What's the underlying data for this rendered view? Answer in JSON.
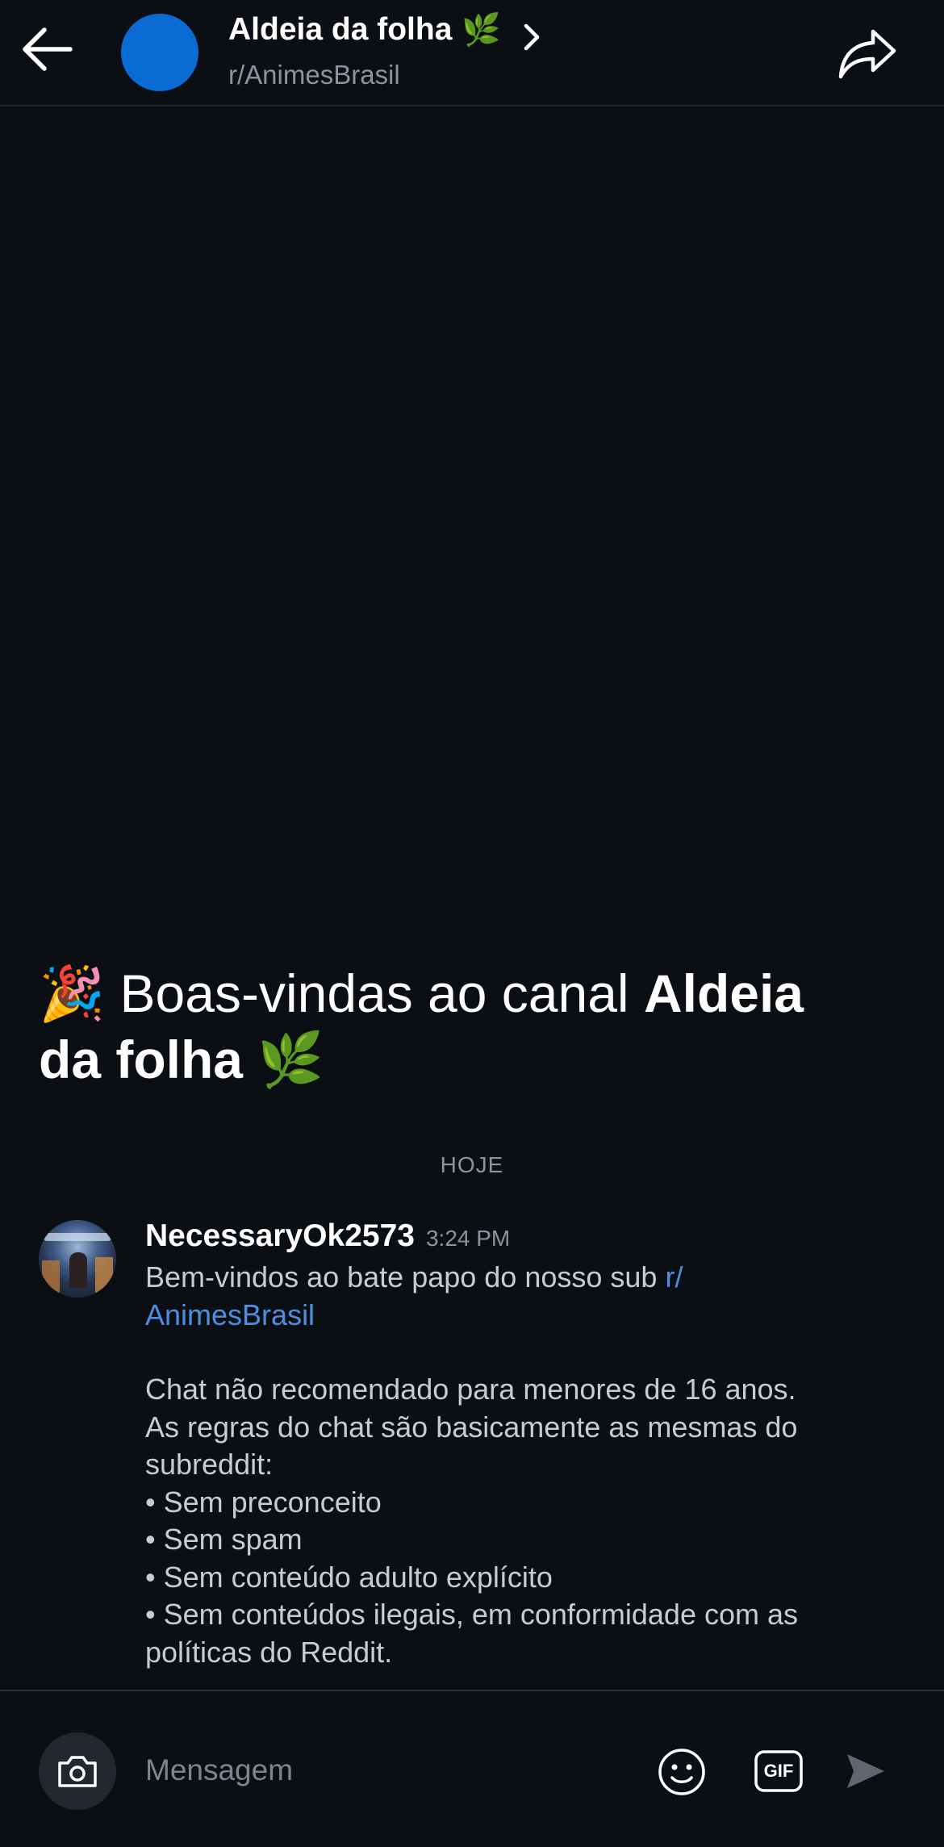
{
  "header": {
    "title": "Aldeia da folha",
    "title_emoji": "🌿",
    "subtitle": "r/AnimesBrasil",
    "avatar_color": "#0a6bd4"
  },
  "welcome": {
    "emoji": "🎉",
    "prefix": "Boas-vindas ao canal",
    "channel_line1": "Aldeia",
    "channel_line2": "da folha",
    "channel_emoji": "🌿"
  },
  "day_divider": "HOJE",
  "message": {
    "username": "NecessaryOk2573",
    "time": "3:24 PM",
    "intro": "Bem-vindos ao bate papo do nosso sub",
    "link_part1": "r/",
    "link_part2": "AnimesBrasil",
    "lines": [
      "Chat não recomendado para menores de 16 anos.",
      "As regras do chat são basicamente as mesmas do",
      "subreddit:",
      "• Sem preconceito",
      "• Sem spam",
      "• Sem conteúdo adulto explícito",
      "• Sem conteúdos ilegais, em conformidade com as",
      "políticas do Reddit."
    ]
  },
  "composer": {
    "placeholder": "Mensagem",
    "gif_label": "GIF"
  },
  "icons": {
    "back": "arrow-left-icon",
    "chevron": "chevron-right-icon",
    "share": "share-icon",
    "camera": "camera-icon",
    "emoji": "smiley-icon",
    "gif": "gif-icon",
    "send": "send-icon"
  },
  "colors": {
    "background": "#0b0f13",
    "link": "#4c8fe0",
    "muted": "#8b949c"
  }
}
